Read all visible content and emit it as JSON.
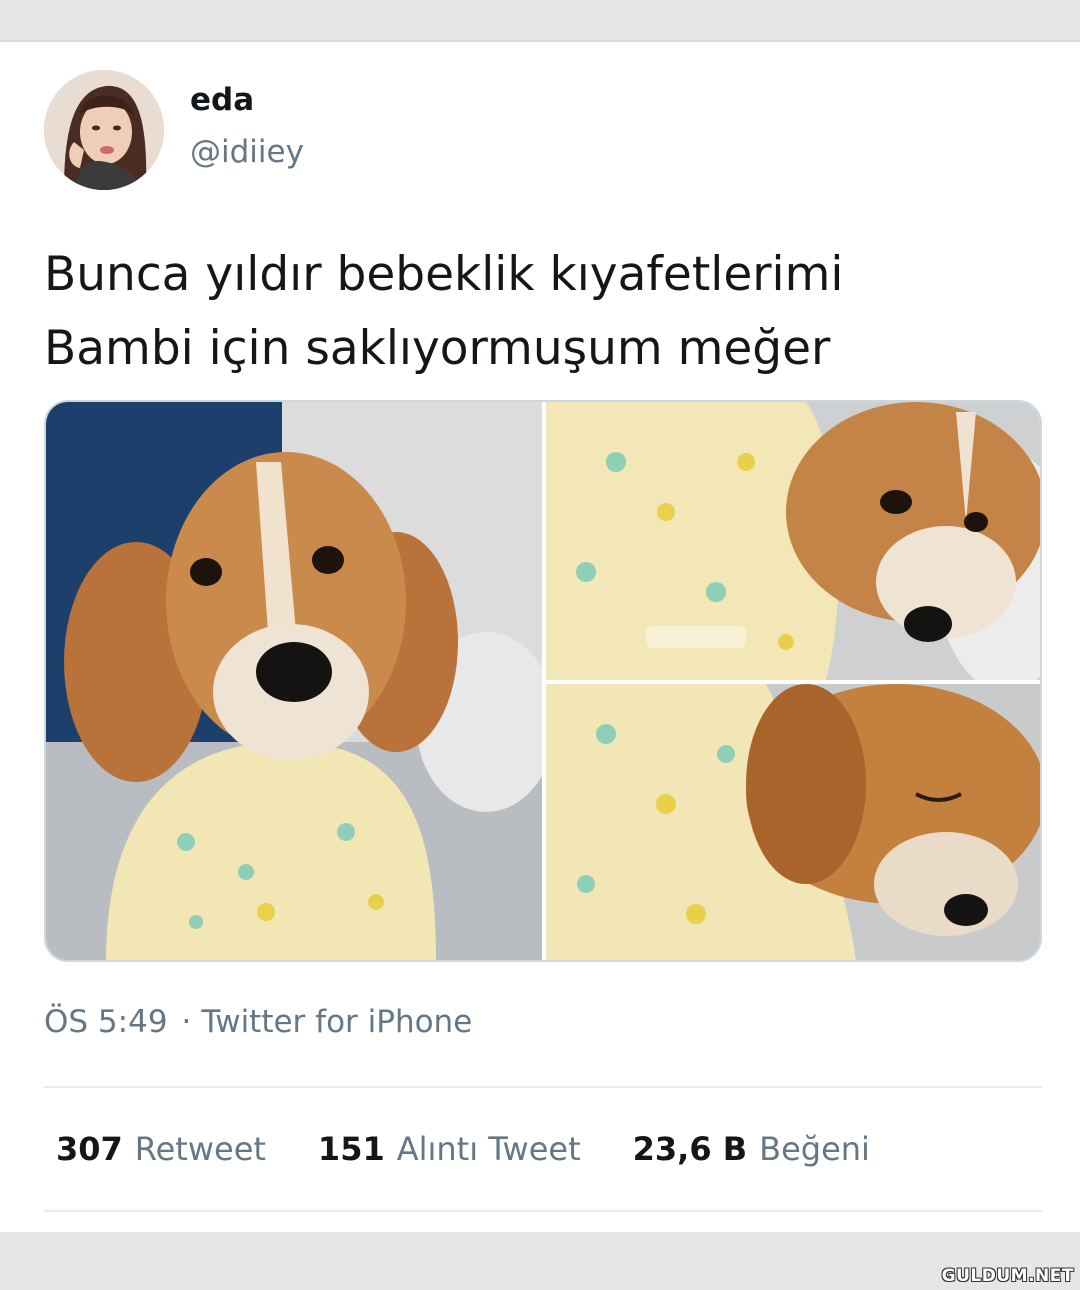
{
  "tweet": {
    "author_name": "eda",
    "author_handle": "@idiiey",
    "text_line_1": "Bunca yıldır bebeklik kıyafetlerimi",
    "text_line_2": "Bambi için saklıyormuşum meğer",
    "time": "ÖS 5:49",
    "separator": "·",
    "source": "Twitter for iPhone"
  },
  "stats": {
    "retweets_count": "307",
    "retweets_label": "Retweet",
    "quotes_count": "151",
    "quotes_label": "Alıntı Tweet",
    "likes_count": "23,6 B",
    "likes_label": "Beğeni"
  },
  "watermark": "GULDUM.NET",
  "colors": {
    "text_primary": "#14171a",
    "text_secondary": "#657786",
    "divider": "#e6ecf0",
    "background": "#e6e6e6"
  }
}
